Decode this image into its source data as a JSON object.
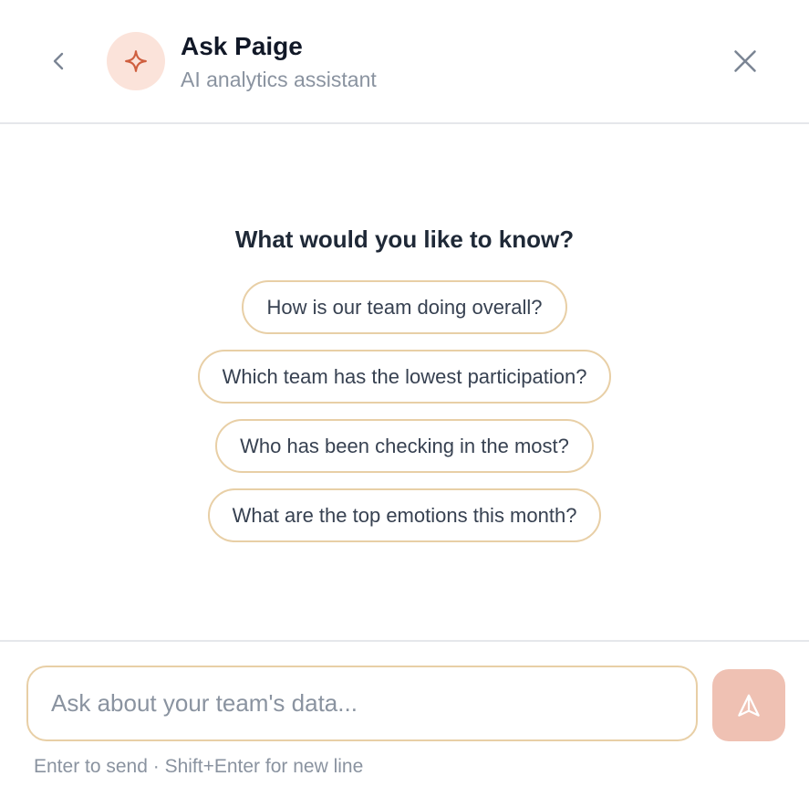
{
  "header": {
    "title": "Ask Paige",
    "subtitle": "AI analytics assistant",
    "back_icon": "chevron-left-icon",
    "avatar_icon": "sparkle-icon",
    "close_icon": "close-icon"
  },
  "main": {
    "heading": "What would you like to know?",
    "suggestions": [
      "How is our team doing overall?",
      "Which team has the lowest participation?",
      "Who has been checking in the most?",
      "What are the top emotions this month?"
    ]
  },
  "footer": {
    "input_value": "",
    "input_placeholder": "Ask about your team's data...",
    "send_icon": "send-icon",
    "hint": "Enter to send · Shift+Enter for new line"
  },
  "colors": {
    "accent": "#e07a5f",
    "avatar_bg": "#fbe3da",
    "chip_border": "#e8cfa6",
    "send_bg": "#efc1b3",
    "muted_text": "#8a93a0"
  }
}
